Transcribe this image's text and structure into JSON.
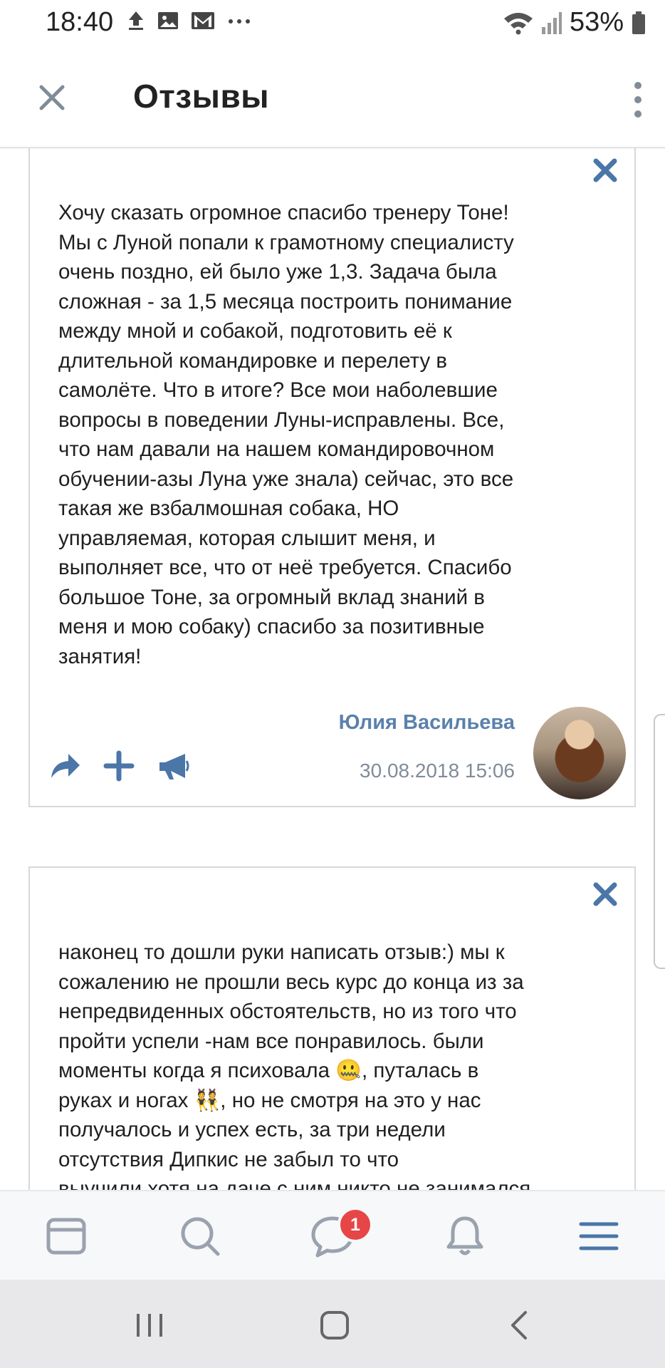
{
  "status_bar": {
    "time": "18:40",
    "battery_percent": "53%",
    "icons": [
      "upload-icon",
      "image-icon",
      "gmail-icon",
      "more-icon",
      "wifi-icon",
      "signal-icon",
      "battery-icon"
    ]
  },
  "app_bar": {
    "title": "Отзывы",
    "close_icon": "close-icon",
    "menu_icon": "more-vertical-icon"
  },
  "reviews": [
    {
      "text": "Хочу сказать огромное спасибо тренеру Тоне!\nМы с Луной попали к грамотному специалисту\nочень поздно, ей было уже 1,3. Задача была\nсложная - за 1,5 месяца построить понимание\nмежду мной и собакой, подготовить её к\nдлительной командировке и перелету в\nсамолёте. Что в итоге? Все мои наболевшие\nвопросы в поведении Луны-исправлены. Все,\nчто нам давали на нашем командировочном\nобучении-азы Луна уже знала) сейчас, это все\nтакая же взбалмошная собака, НО\nуправляемая, которая слышит меня, и\nвыполняет все, что от неё требуется. Спасибо\nбольшое Тоне, за огромный вклад знаний в\nменя и мою собаку) спасибо за позитивные\nзанятия!",
      "author": "Юлия Васильева",
      "date": "30.08.2018 15:06"
    },
    {
      "text": "наконец то дошли руки написать отзыв:) мы к\nсожалению не прошли весь курс до конца из за\nнепредвиденных обстоятельств, но из того что\nпройти успели -нам все понравилось. были\nмоменты когда я психовала 🤐, путалась в\nруках и ногах 👯, но не смотря на это у нас\nполучалось и успех есть, за три недели\nотсутствия Дипкис не забыл то что\nвыучили хотя на даче с ним никто не занимался"
    }
  ],
  "bottom_nav": {
    "items": [
      "news-icon",
      "search-icon",
      "messages-icon",
      "notifications-icon",
      "menu-icon"
    ],
    "messages_badge": "1"
  },
  "colors": {
    "accent": "#4a76a8",
    "link_name": "#5b81ad",
    "date_gray": "#818c99",
    "badge_red": "#e64646"
  }
}
